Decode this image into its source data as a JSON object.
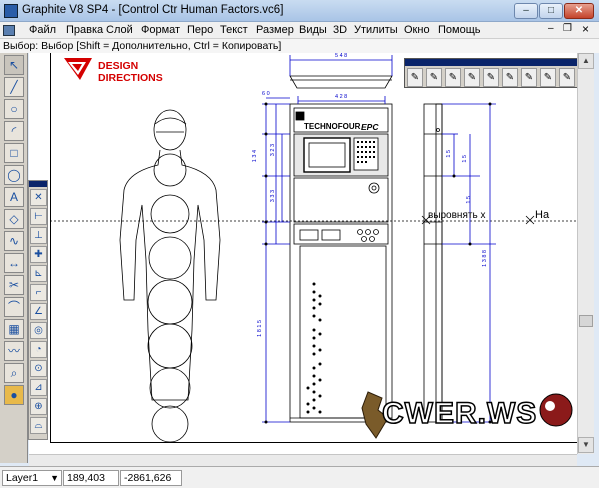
{
  "window": {
    "title": "Graphite V8 SP4 - [Control Ctr Human Factors.vc6]",
    "buttons": {
      "minimize": "–",
      "maximize": "□",
      "close": "✕"
    }
  },
  "menu": [
    "Файл",
    "Правка",
    "Слой",
    "Формат",
    "Перо",
    "Текст",
    "Размер",
    "Виды",
    "3D",
    "Утилиты",
    "Окно",
    "Помощь"
  ],
  "doc_controls": {
    "minimize": "–",
    "restore": "❐",
    "close": "×"
  },
  "hint": "Выбор: Выбор  [Shift = Дополнительно, Ctrl = Копировать]",
  "logo": {
    "line1": "DESIGN",
    "line2": "DIRECTIONS"
  },
  "drawing": {
    "brand": "TECHNOFOUR",
    "model": "EPC",
    "snap_label": "выровнять x",
    "snap_label2": "На",
    "dims": {
      "top_width": "5 4 8",
      "body_width": "4 2 8",
      "left_offset": "6 0",
      "d1": "1 3 4",
      "d2": "3 2 3",
      "d3": "3 3 3",
      "d4": "1 8 1 5",
      "d5": "1 5",
      "d6": "1 5",
      "d7": "1 5",
      "d8": "1 3 8 8"
    }
  },
  "status": {
    "layer": "Layer1",
    "x": "189,403",
    "y": "-2861,626"
  },
  "watermark": "CWER.WS"
}
